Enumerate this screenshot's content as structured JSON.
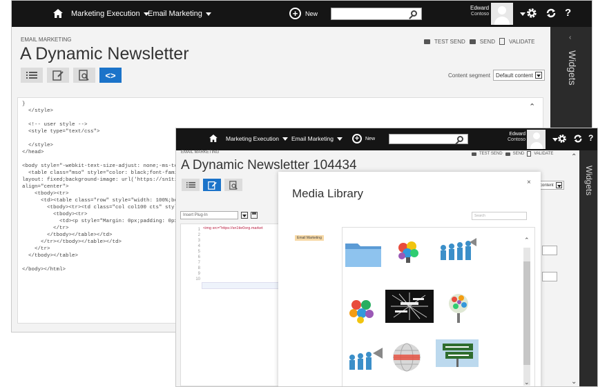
{
  "colors": {
    "topbar": "#151515",
    "accent": "#1b73c9",
    "widgets_panel": "#2b2b2b",
    "logo": [
      "#f25022",
      "#7fba00",
      "#00a4ef",
      "#ffb900"
    ]
  },
  "window1": {
    "nav": {
      "home_icon": "home-icon",
      "menu1": "Marketing Execution",
      "menu2": "Email Marketing",
      "new": "New",
      "search_icon": "search-icon",
      "user_name": "Edward",
      "user_org": "Contoso",
      "settings_icon": "gear-icon",
      "refresh_icon": "refresh-icon",
      "help": "?"
    },
    "breadcrumb": "EMAIL MARKETING",
    "title": "A Dynamic Newsletter",
    "actions": {
      "test_send": "TEST SEND",
      "send": "SEND",
      "validate": "VALIDATE"
    },
    "segment_label": "Content segment",
    "segment_value": "Default content",
    "widgets": "Widgets",
    "code_lines": [
      "}",
      "  </style>",
      "",
      "  <!-- user style -->",
      "  <style type=\"text/css\">",
      "",
      "  </style>",
      "</head>",
      "",
      "<body style=\"-webkit-text-size-adjust: none;-ms-text-size-adju",
      "  <table class=\"mso\" style=\"color: black;font-family: Arial, Helve",
      "layout: fixed;background-image: url('https://sn1tie0org.marketi",
      "align=\"center\">",
      "    <tbody><tr>",
      "      <td><table class=\"row\" style=\"width: 100%;border-collaps",
      "        <tbody><tr><td class=\"col col100 cts\" style=\"display: tal",
      "          <tbody><tr>",
      "            <td><p style=\"Margin: 0px;padding: 0px\"><font color",
      "          </tr>",
      "        </tbody></table></td>",
      "      </tr></tbody></table></td>",
      "    </tr>",
      "  </tbody></table>",
      "",
      "</body></html>"
    ]
  },
  "window2": {
    "nav": {
      "menu1": "Marketing Execution",
      "menu2": "Email Marketing",
      "new": "New",
      "user_name": "Edward",
      "user_org": "Contoso",
      "help": "?"
    },
    "breadcrumb": "EMAIL MARKETING",
    "title": "A Dynamic Newsletter 104434",
    "actions": {
      "test_send": "TEST SEND",
      "send": "SEND",
      "validate": "VALIDATE"
    },
    "segment_value": "content",
    "widgets": "Widgets",
    "plugin_label": "Insert Plug-In",
    "code_line1": "<img src=\"https://sn1tie0org.market",
    "line_numbers": [
      "1",
      "2",
      "3",
      "4",
      "5",
      "6",
      "7",
      "8",
      "9",
      "10"
    ],
    "media_library": {
      "title": "Media Library",
      "close": "×",
      "search_placeholder": "Search",
      "folder": "Email Marketing",
      "images": [
        "folder-icon",
        "colorful-people-puzzle-image",
        "team-megaphone-image",
        "puzzle-people-image",
        "marketing-word-cloud-image",
        "colorful-tree-head-image",
        "team-megaphone-image-2",
        "marketing-globe-image",
        "marketing-strategy-sign-image"
      ]
    }
  }
}
